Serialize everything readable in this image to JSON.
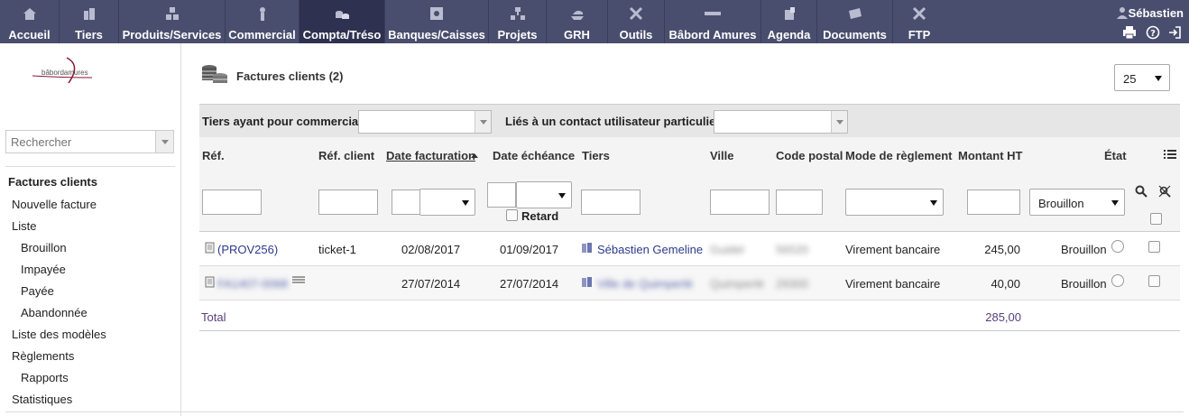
{
  "nav": {
    "items": [
      {
        "label": "Accueil",
        "icon": "home-icon"
      },
      {
        "label": "Tiers",
        "icon": "building-icon"
      },
      {
        "label": "Produits/Services",
        "icon": "boxes-icon"
      },
      {
        "label": "Commercial",
        "icon": "briefcase-icon"
      },
      {
        "label": "Compta/Tréso",
        "icon": "coins-icon"
      },
      {
        "label": "Banques/Caisses",
        "icon": "safe-icon"
      },
      {
        "label": "Projets",
        "icon": "hierarchy-icon"
      },
      {
        "label": "GRH",
        "icon": "boat-icon"
      },
      {
        "label": "Outils",
        "icon": "tools-icon"
      },
      {
        "label": "Bâbord Amures",
        "icon": "ruler-icon"
      },
      {
        "label": "Agenda",
        "icon": "agenda-icon"
      },
      {
        "label": "Documents",
        "icon": "folder-icon"
      },
      {
        "label": "FTP",
        "icon": "tools-icon"
      }
    ],
    "active_index": 4,
    "user_name": "Sébastien"
  },
  "sidebar": {
    "logo_text": "bâbordamures",
    "search_placeholder": "Rechercher",
    "menu": [
      {
        "label": "Factures clients",
        "level": "head"
      },
      {
        "label": "Nouvelle facture",
        "level": "top"
      },
      {
        "label": "Liste",
        "level": "top"
      },
      {
        "label": "Brouillon",
        "level": "sub"
      },
      {
        "label": "Impayée",
        "level": "sub"
      },
      {
        "label": "Payée",
        "level": "sub"
      },
      {
        "label": "Abandonnée",
        "level": "sub"
      },
      {
        "label": "Liste des modèles",
        "level": "top"
      },
      {
        "label": "Règlements",
        "level": "top"
      },
      {
        "label": "Rapports",
        "level": "sub"
      },
      {
        "label": "Statistiques",
        "level": "top"
      }
    ]
  },
  "main": {
    "title": "Factures clients (2)",
    "limit_value": "25",
    "filters": {
      "sales_rep_label": "Tiers ayant pour commercial:",
      "contact_label": "Liés à un contact utilisateur particulier:"
    },
    "columns": {
      "ref": "Réf.",
      "ref_client": "Réf. client",
      "date_invoice": "Date facturation",
      "date_due": "Date échéance",
      "thirdparty": "Tiers",
      "town": "Ville",
      "zip": "Code postal",
      "payment_mode": "Mode de règlement",
      "amount": "Montant HT",
      "status": "État"
    },
    "search": {
      "late_label": "Retard",
      "status_value": "Brouillon"
    },
    "rows": [
      {
        "ref": "(PROV256)",
        "ref_client": "ticket-1",
        "date_invoice": "02/08/2017",
        "date_due": "01/09/2017",
        "thirdparty": "Sébastien Gemeline",
        "town": "Guidel",
        "zip": "56520",
        "payment_mode": "Virement bancaire",
        "amount": "245,00",
        "status": "Brouillon"
      },
      {
        "ref": "FA1407-0068",
        "ref_client": "",
        "date_invoice": "27/07/2014",
        "date_due": "27/07/2014",
        "thirdparty": "Ville de Quimperlé",
        "town": "Quimperlé",
        "zip": "29300",
        "payment_mode": "Virement bancaire",
        "amount": "40,00",
        "status": "Brouillon"
      }
    ],
    "total_label": "Total",
    "total_amount": "285,00"
  }
}
